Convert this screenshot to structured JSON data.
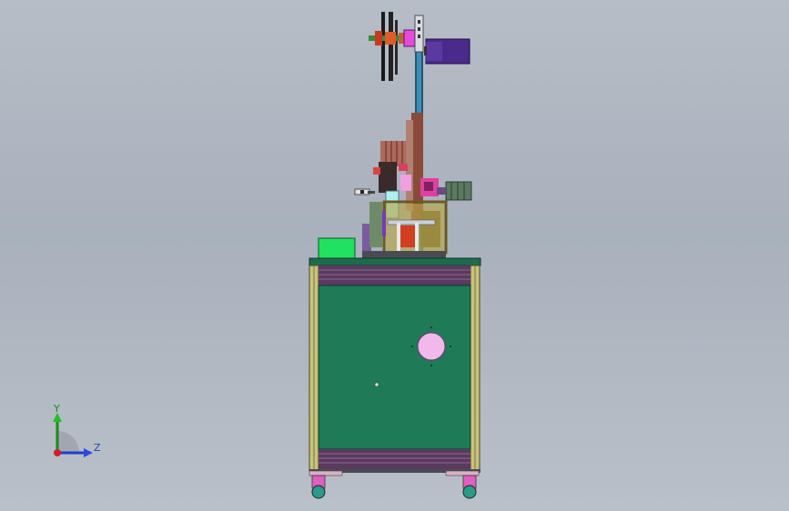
{
  "viewport": {
    "background_top": "#b6bdc6",
    "background_bottom": "#b9c0c8"
  },
  "triad": {
    "y_label": "Y",
    "z_label": "Z",
    "y_color": "#1d8a1d",
    "z_color": "#1f3fc8",
    "x_color": "#d02020"
  },
  "colors": {
    "cabinet_panel": "#1f7a58",
    "cabinet_frame": "#c8c37a",
    "cabinet_rail": "#5a3a5e",
    "top_plate": "#1e6b4c",
    "spindle_blue": "#3a8fb8",
    "motor_purple": "#4a2a8a",
    "green_block": "#22e060",
    "pink_port": "#f2b8ea"
  }
}
